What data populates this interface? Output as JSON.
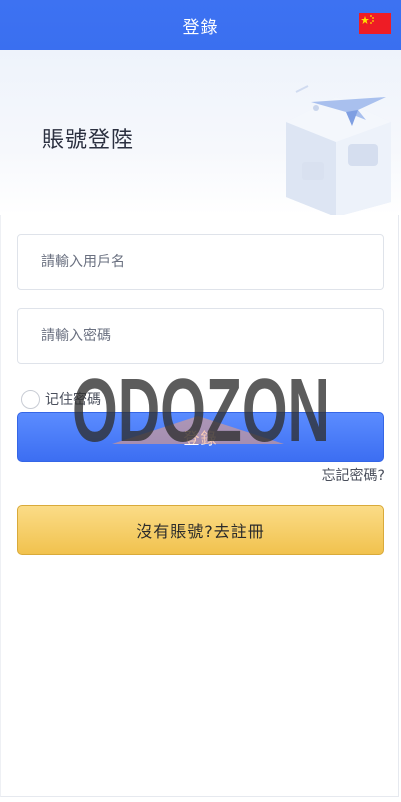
{
  "header": {
    "title": "登錄",
    "flag_icon": "china-flag-icon"
  },
  "hero": {
    "title": "賬號登陸"
  },
  "form": {
    "username_placeholder": "請輸入用戶名",
    "password_placeholder": "請輸入密碼",
    "remember_label": "记住密碼",
    "login_label": "登錄",
    "forgot_label": "忘記密碼?",
    "register_label": "沒有賬號?去註冊"
  },
  "watermark": {
    "text": "ODOZON"
  },
  "colors": {
    "header": "#3a6ff0",
    "login_button": "#4a7df7",
    "register_button": "#f4c95c",
    "flag_red": "#ee1c25",
    "flag_star": "#ffde00"
  }
}
